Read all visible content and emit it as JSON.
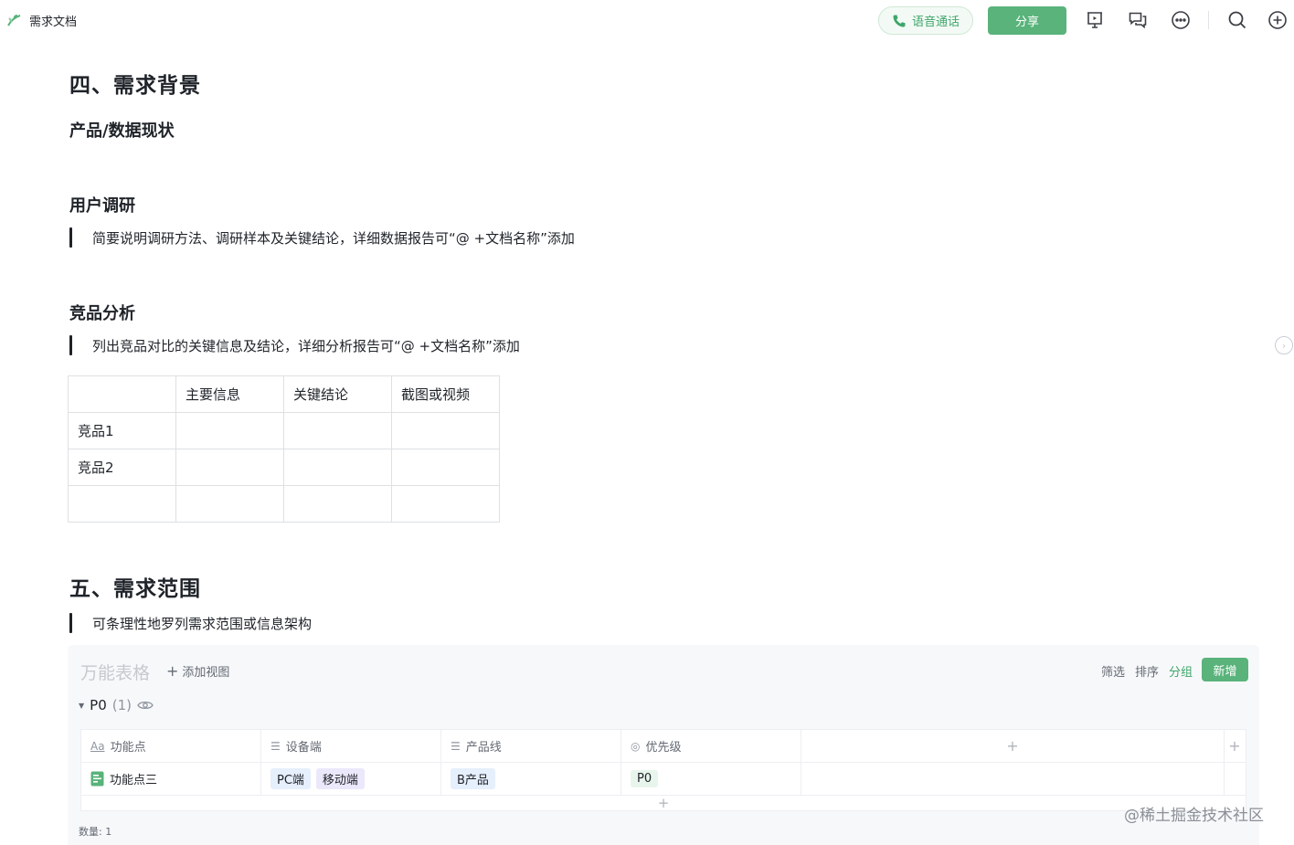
{
  "header": {
    "doc_title": "需求文档",
    "voice_call_label": "语音通话",
    "share_label": "分享"
  },
  "icons": [
    "leaf-icon",
    "phone-icon",
    "present-icon",
    "comment-icon",
    "more-icon",
    "search-icon",
    "add-circle-icon"
  ],
  "colors": {
    "accent": "#59b37a",
    "text": "#1f2329",
    "muted": "#646a73"
  },
  "section4": {
    "title": "四、需求背景",
    "product_data_heading": "产品/数据现状",
    "user_research_heading": "用户调研",
    "user_research_quote": "简要说明调研方法、调研样本及关键结论，详细数据报告可“@ +文档名称”添加",
    "competitor_heading": "竞品分析",
    "competitor_quote": "列出竞品对比的关键信息及结论，详细分析报告可“@ +文档名称”添加",
    "table": {
      "headers": [
        "",
        "主要信息",
        "关键结论",
        "截图或视频"
      ],
      "rows": [
        [
          "竞品1",
          "",
          "",
          ""
        ],
        [
          "竞品2",
          "",
          "",
          ""
        ],
        [
          "",
          "",
          "",
          ""
        ]
      ]
    }
  },
  "section5": {
    "title": "五、需求范围",
    "quote": "可条理性地罗列需求范围或信息架构"
  },
  "bitable": {
    "title": "万能表格",
    "add_view_label": "添加视图",
    "filter_label": "筛选",
    "sort_label": "排序",
    "group_label": "分组",
    "new_label": "新增",
    "group_name": "P0",
    "group_count": "(1)",
    "columns": [
      {
        "icon": "Aa",
        "label": "功能点"
      },
      {
        "icon": "☰",
        "label": "设备端"
      },
      {
        "icon": "☰",
        "label": "产品线"
      },
      {
        "icon": "◎",
        "label": "优先级"
      }
    ],
    "row": {
      "feature": "功能点三",
      "devices": [
        "PC端",
        "移动端"
      ],
      "product_line": "B产品",
      "priority": "P0"
    },
    "count_text": "数量: 1"
  },
  "watermark": "@稀土掘金技术社区"
}
